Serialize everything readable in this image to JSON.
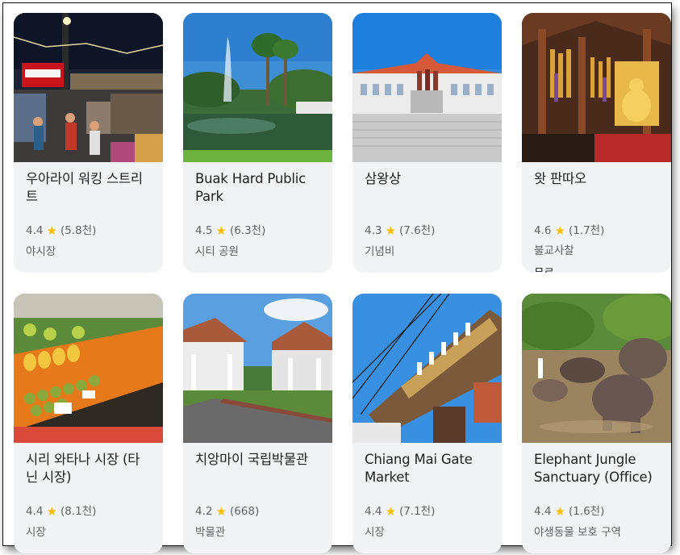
{
  "places": [
    {
      "name": "우아라이 워킹 스트리트",
      "rating": "4.4",
      "reviews": "(5.8천)",
      "category": "야시장",
      "price": ""
    },
    {
      "name": "Buak Hard Public Park",
      "rating": "4.5",
      "reviews": "(6.3천)",
      "category": "시티 공원",
      "price": ""
    },
    {
      "name": "삼왕상",
      "rating": "4.3",
      "reviews": "(7.6천)",
      "category": "기념비",
      "price": ""
    },
    {
      "name": "왓 판따오",
      "rating": "4.6",
      "reviews": "(1.7천)",
      "category": "불교사찰",
      "price": "무료"
    },
    {
      "name": "시리 와타나 시장 (타닌 시장)",
      "rating": "4.4",
      "reviews": "(8.1천)",
      "category": "시장",
      "price": ""
    },
    {
      "name": "치앙마이 국립박물관",
      "rating": "4.2",
      "reviews": "(668)",
      "category": "박물관",
      "price": ""
    },
    {
      "name": "Chiang Mai Gate Market",
      "rating": "4.4",
      "reviews": "(7.1천)",
      "category": "시장",
      "price": ""
    },
    {
      "name": "Elephant Jungle Sanctuary (Office)",
      "rating": "4.4",
      "reviews": "(1.6천)",
      "category": "야생동물 보호 구역",
      "price": ""
    }
  ],
  "icons": {
    "rating": "star-icon"
  },
  "colors": {
    "star": "#fbbc04",
    "card_bg": "#f1f3f4",
    "secondary_text": "#5f6368"
  }
}
